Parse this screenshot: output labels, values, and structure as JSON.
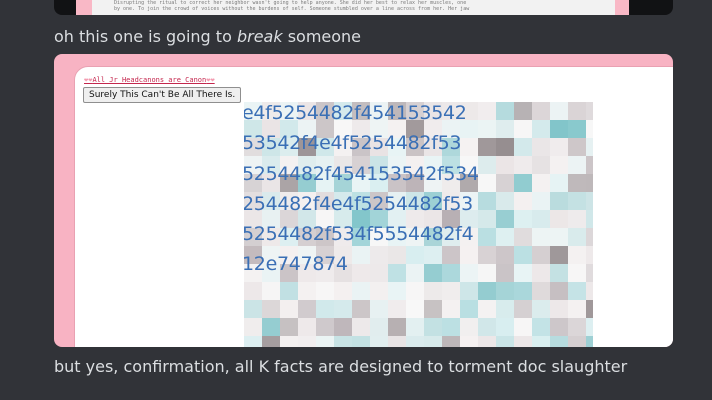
{
  "previous_embed": {
    "snippet_lines": [
      "Disrupting the ritual to correct her neighbor wasn't going to help anyone. She did her best to relax her muscles, one",
      "by one. To join the crowd of voices without the burdens of self. Someone stumbled over a line across from her. Her jaw"
    ]
  },
  "messages": [
    {
      "pre": "oh this one is going to ",
      "emph": "break",
      "post": " someone"
    },
    {
      "text": "but yes, confirmation, all K facts are designed to torment doc slaughter"
    }
  ],
  "embed": {
    "hearts_left": "❤❤",
    "hearts_right": "❤❤",
    "site_title": "All Jr Headcanons are Canon",
    "button_label": "Surely This Can't Be All There Is.",
    "glitch_text_lines": [
      "e4f5254482f454153542",
      "53542f4e4f5254482f53",
      "5254482f454153542f534",
      "254482f4e4f5254482f53",
      "5254482f534f5554482f4",
      "12e747874"
    ]
  }
}
